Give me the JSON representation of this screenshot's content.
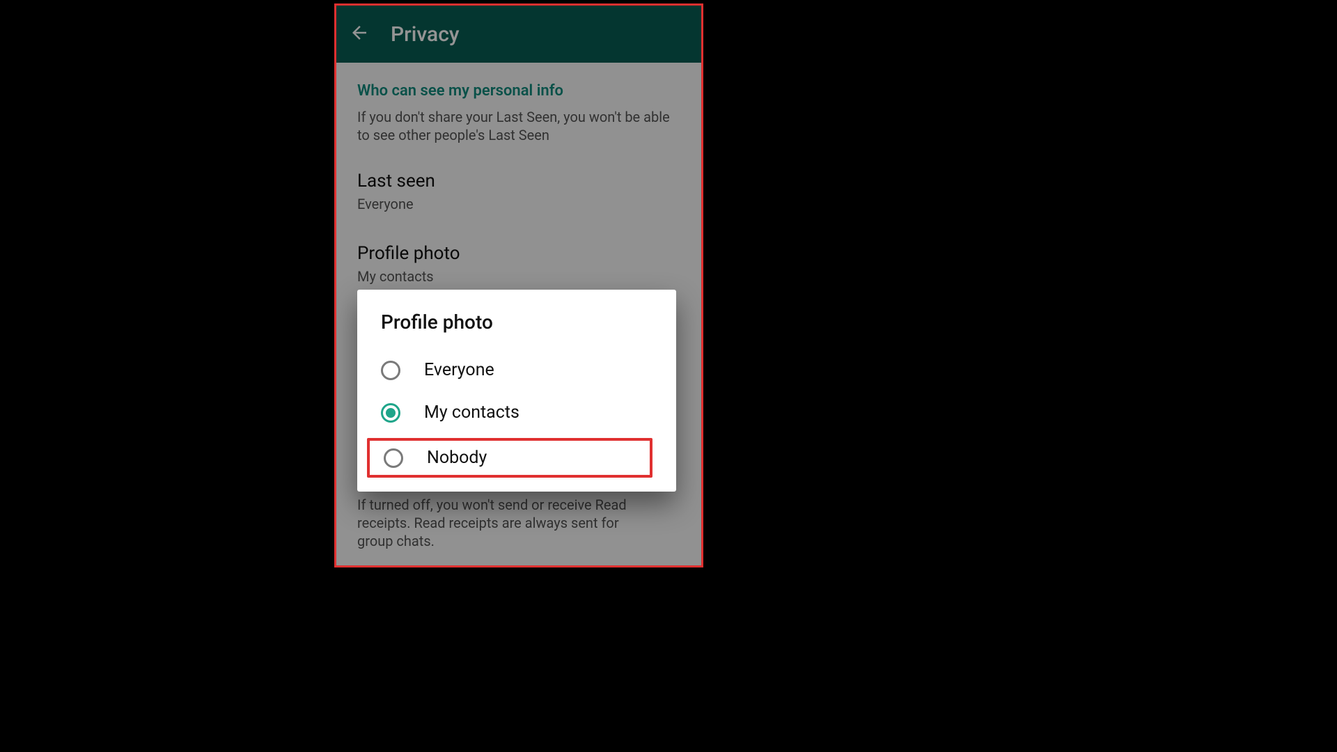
{
  "appbar": {
    "title": "Privacy"
  },
  "section": {
    "header": "Who can see my personal info",
    "sub": "If you don't share your Last Seen, you won't be able to see other people's Last Seen"
  },
  "prefs": {
    "lastSeen": {
      "title": "Last seen",
      "value": "Everyone"
    },
    "profilePhoto": {
      "title": "Profile photo",
      "value": "My contacts"
    }
  },
  "readReceipts": {
    "note": "If turned off, you won't send or receive Read receipts. Read receipts are always sent for group chats."
  },
  "dialog": {
    "title": "Profile photo",
    "options": [
      {
        "label": "Everyone",
        "selected": false
      },
      {
        "label": "My contacts",
        "selected": true
      },
      {
        "label": "Nobody",
        "selected": false
      }
    ]
  },
  "colors": {
    "accent": "#128c7e",
    "appbar": "#075e54",
    "highlight": "#e03030"
  }
}
